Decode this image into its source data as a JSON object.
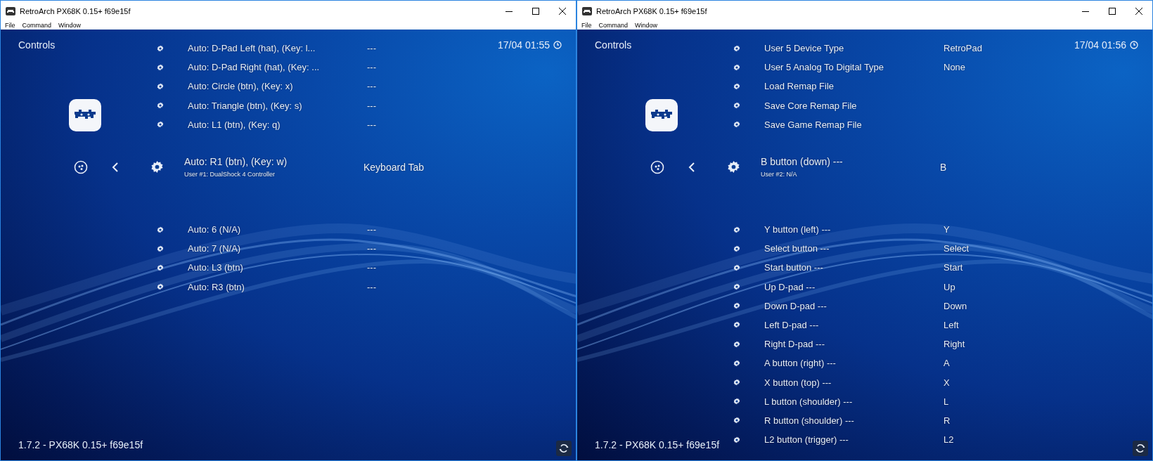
{
  "windows": [
    {
      "title": "RetroArch PX68K 0.15+ f69e15f",
      "menu": [
        "File",
        "Command",
        "Window"
      ],
      "header": "Controls",
      "clock": "17/04 01:55",
      "version": "1.7.2 - PX68K 0.15+ f69e15f",
      "items": [
        {
          "label": "Auto:  D-Pad Left (hat), (Key: l...",
          "value": "---",
          "selected": false
        },
        {
          "label": "Auto:  D-Pad Right (hat), (Key: ...",
          "value": "---",
          "selected": false
        },
        {
          "label": "Auto: Circle (btn), (Key: x)",
          "value": "---",
          "selected": false
        },
        {
          "label": "Auto: Triangle (btn), (Key: s)",
          "value": "---",
          "selected": false
        },
        {
          "label": "Auto: L1 (btn), (Key: q)",
          "value": "---",
          "selected": false
        },
        {
          "label": "Auto: R1 (btn), (Key: w)",
          "sublabel": "User #1: DualShock 4 Controller",
          "value": "Keyboard Tab",
          "selected": true
        },
        {
          "label": "Auto: 6 (N/A)",
          "value": "---",
          "selected": false
        },
        {
          "label": "Auto: 7 (N/A)",
          "value": "---",
          "selected": false
        },
        {
          "label": "Auto: L3 (btn)",
          "value": "---",
          "selected": false
        },
        {
          "label": "Auto: R3 (btn)",
          "value": "---",
          "selected": false
        }
      ]
    },
    {
      "title": "RetroArch PX68K 0.15+ f69e15f",
      "menu": [
        "File",
        "Command",
        "Window"
      ],
      "header": "Controls",
      "clock": "17/04 01:56",
      "version": "1.7.2 - PX68K 0.15+ f69e15f",
      "items": [
        {
          "label": "User 5 Device Type",
          "value": "RetroPad",
          "selected": false
        },
        {
          "label": "User 5 Analog To Digital Type",
          "value": "None",
          "selected": false
        },
        {
          "label": "Load Remap File",
          "selected": false
        },
        {
          "label": "Save Core Remap File",
          "selected": false
        },
        {
          "label": "Save Game Remap File",
          "selected": false
        },
        {
          "label": "B button (down) ---",
          "sublabel": "User #2: N/A",
          "value": "B",
          "selected": true
        },
        {
          "label": "Y button (left) ---",
          "value": "Y",
          "selected": false
        },
        {
          "label": "Select button ---",
          "value": "Select",
          "selected": false
        },
        {
          "label": "Start button ---",
          "value": "Start",
          "selected": false
        },
        {
          "label": "Up D-pad ---",
          "value": "Up",
          "selected": false
        },
        {
          "label": "Down D-pad ---",
          "value": "Down",
          "selected": false
        },
        {
          "label": "Left D-pad ---",
          "value": "Left",
          "selected": false
        },
        {
          "label": "Right D-pad ---",
          "value": "Right",
          "selected": false
        },
        {
          "label": "A button (right) ---",
          "value": "A",
          "selected": false
        },
        {
          "label": "X button (top) ---",
          "value": "X",
          "selected": false
        },
        {
          "label": "L button (shoulder) ---",
          "value": "L",
          "selected": false
        },
        {
          "label": "R button (shoulder) ---",
          "value": "R",
          "selected": false
        },
        {
          "label": "L2 button (trigger) ---",
          "value": "L2",
          "selected": false
        }
      ]
    }
  ]
}
